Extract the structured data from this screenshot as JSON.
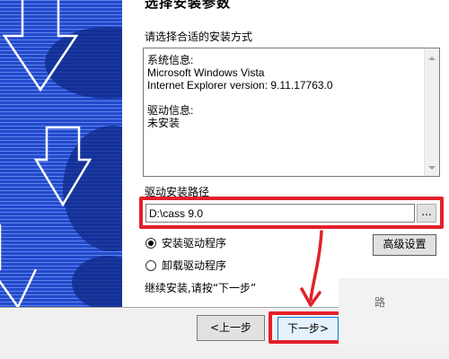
{
  "heading": "选择安装参数",
  "prompt": "请选择合适的安装方式",
  "info": {
    "text": "系统信息:\nMicrosoft Windows Vista\nInternet Explorer version: 9.11.17763.0\n\n驱动信息:\n未安装"
  },
  "path": {
    "label": "驱动安装路径",
    "value": "D:\\cass 9.0",
    "browse_label": "..."
  },
  "options": [
    {
      "label": "安装驱动程序",
      "checked": true
    },
    {
      "label": "卸载驱动程序",
      "checked": false
    }
  ],
  "advanced_label": "高级设置",
  "hint": "继续安装,请按“下一步”",
  "footer": {
    "prev_label": "<上一步",
    "next_label": "下一步>"
  },
  "watermark": "路",
  "colors": {
    "highlight": "#e2202a",
    "banner_blue": "#1f43c8",
    "arrow_stroke": "#ffffff"
  }
}
